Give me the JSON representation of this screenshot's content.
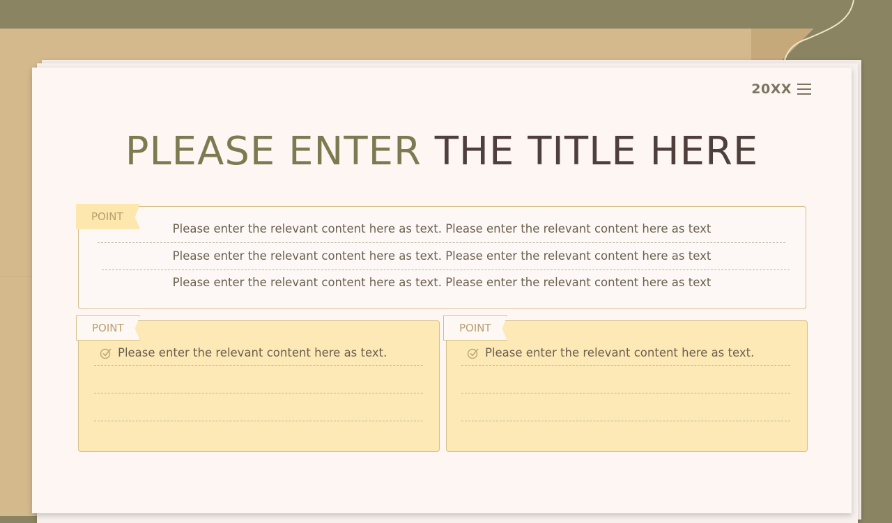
{
  "header": {
    "year": "20XX"
  },
  "title": {
    "part1": "PLEASE ENTER",
    "part2": "THE TITLE HERE"
  },
  "top_card": {
    "tag": "POINT",
    "lines": [
      "Please enter the relevant content here as text. Please enter the relevant content here as text",
      "Please enter the relevant content here as text. Please enter the relevant content here as text",
      "Please enter the relevant content here as text. Please enter the relevant content here as text"
    ]
  },
  "left_card": {
    "tag": "POINT",
    "item": "Please enter the relevant content here as text."
  },
  "right_card": {
    "tag": "POINT",
    "item": "Please enter the relevant content here as text."
  },
  "colors": {
    "background": "#8a8462",
    "envelope": "#d4b98c",
    "paper": "#fdf6f3",
    "card_yellow": "#fde9b6",
    "title_olive": "#7d7a52",
    "title_dark": "#4f3f3c"
  },
  "icons": [
    "menu-icon",
    "check-circle-icon"
  ]
}
